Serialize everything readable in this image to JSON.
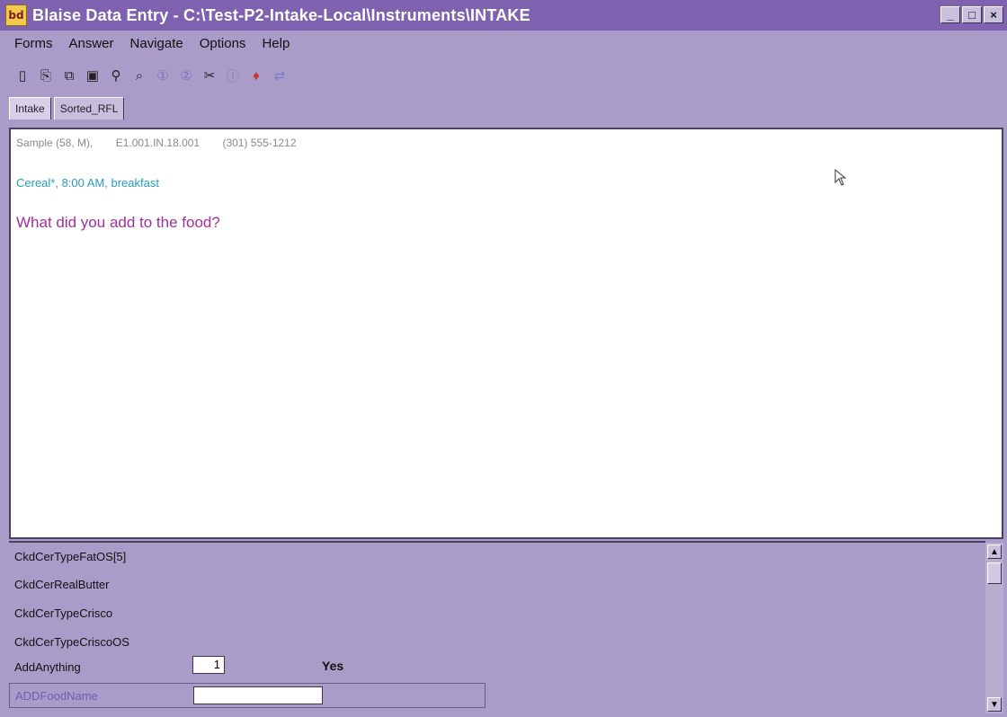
{
  "window": {
    "title": "Blaise Data Entry - C:\\Test-P2-Intake-Local\\Instruments\\INTAKE",
    "app_icon_text": "bd",
    "controls": [
      "_",
      "□",
      "×"
    ]
  },
  "menu": [
    "Forms",
    "Answer",
    "Navigate",
    "Options",
    "Help"
  ],
  "toolbar": {
    "icons": [
      "new-icon",
      "open-icon",
      "copy-icon",
      "save-icon",
      "search-icon",
      "find-icon",
      "help-icon",
      "info-icon",
      "attach-icon",
      "info-circle-icon",
      "remark-icon",
      "link-icon"
    ],
    "glyphs": [
      "▯",
      "⎘",
      "⧉",
      "▣",
      "⚲",
      "⌕",
      "①",
      "②",
      "✂",
      "ⓘ",
      "♦",
      "⇄"
    ]
  },
  "tabs": [
    "Intake",
    "Sorted_RFL"
  ],
  "main": {
    "respondent": "Sample (58, M),",
    "id": "E1.001.IN.18.001",
    "phone": "(301) 555-1212",
    "context": "Cereal*, 8:00 AM, breakfast",
    "question": "What did you add to the food?"
  },
  "fields": [
    {
      "name": "CkdCerTypeFatOS[5]"
    },
    {
      "name": "CkdCerRealButter"
    },
    {
      "name": "CkdCerTypeCrisco"
    },
    {
      "name": "CkdCerTypeCriscoOS"
    },
    {
      "name": "AddAnything",
      "value": "1",
      "label": "Yes"
    },
    {
      "name": "ADDFoodName",
      "value": ""
    }
  ]
}
